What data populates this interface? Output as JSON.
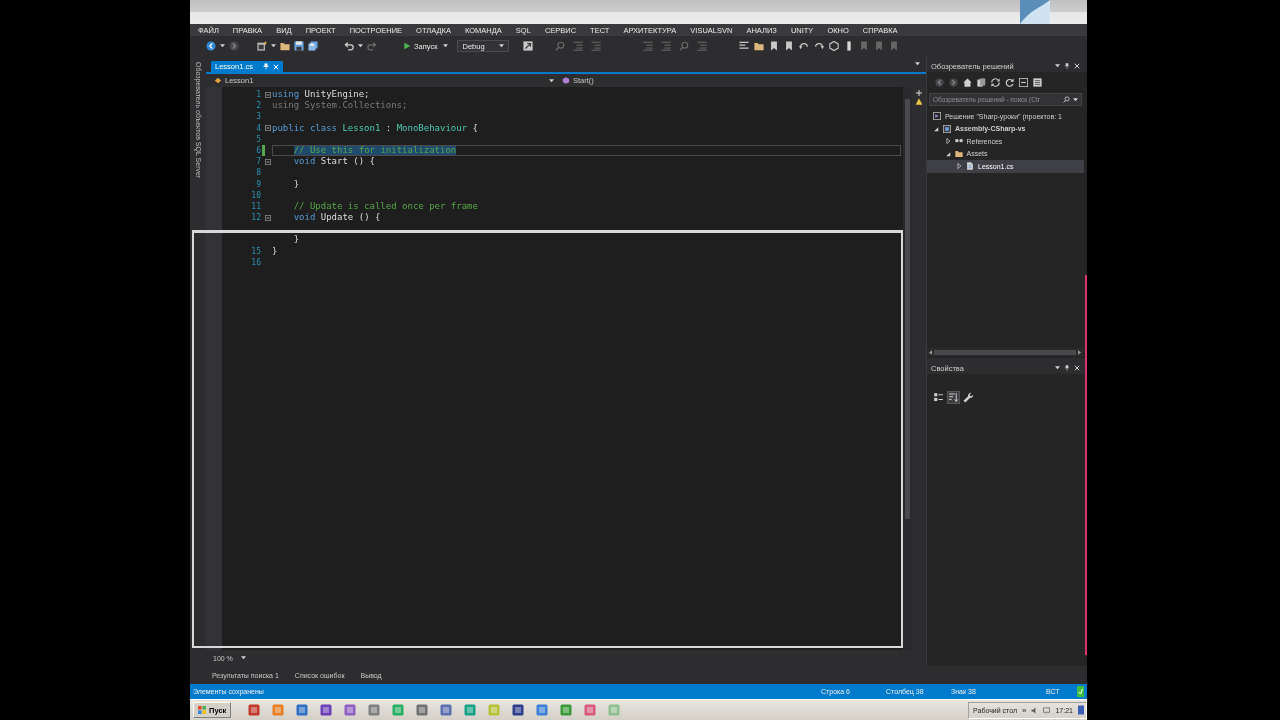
{
  "menu": [
    "ФАЙЛ",
    "ПРАВКА",
    "ВИД",
    "ПРОЕКТ",
    "ПОСТРОЕНИЕ",
    "ОТЛАДКА",
    "КОМАНДА",
    "SQL",
    "СЕРВИС",
    "ТЕСТ",
    "АРХИТЕКТУРА",
    "VISUALSVN",
    "АНАЛИЗ",
    "UNITY",
    "ОКНО",
    "СПРАВКА"
  ],
  "toolbar": {
    "run_label": "Запуск",
    "configuration": "Debug"
  },
  "side_tab": {
    "label": "Обозреватель объектов SQL Server"
  },
  "editor": {
    "tabs": [
      {
        "label": "Lesson1.cs",
        "selected": true
      }
    ],
    "navigation": {
      "type": "Lesson1",
      "member": "Start()"
    },
    "lines": [
      {
        "number": "1",
        "changed": false,
        "foldable": true,
        "current": false,
        "tokens": [
          {
            "text": "using",
            "kind": "keyword",
            "highlighted": false
          },
          {
            "text": " UnityEngine;",
            "kind": "plain",
            "highlighted": false
          }
        ]
      },
      {
        "number": "2",
        "changed": false,
        "foldable": false,
        "current": false,
        "tokens": [
          {
            "text": "using System.Collections;",
            "kind": "dim",
            "highlighted": false
          }
        ]
      },
      {
        "number": "3",
        "changed": false,
        "foldable": false,
        "current": false
      },
      {
        "number": "4",
        "changed": false,
        "foldable": true,
        "current": false,
        "tokens": [
          {
            "text": "public class",
            "kind": "keyword",
            "highlighted": false
          },
          {
            "text": " Lesson1",
            "kind": "type",
            "highlighted": false
          },
          {
            "text": " : ",
            "kind": "plain",
            "highlighted": false
          },
          {
            "text": "MonoBehaviour",
            "kind": "type",
            "highlighted": false
          },
          {
            "text": " {",
            "kind": "plain",
            "highlighted": false
          }
        ]
      },
      {
        "number": "5",
        "changed": false,
        "foldable": false,
        "current": false
      },
      {
        "number": "6",
        "changed": true,
        "foldable": false,
        "current": true,
        "tokens": [
          {
            "text": "    // Use this for initialization",
            "kind": "comment",
            "highlighted": true
          }
        ]
      },
      {
        "number": "7",
        "changed": false,
        "foldable": true,
        "current": false,
        "tokens": [
          {
            "text": "    void",
            "kind": "keyword",
            "highlighted": false
          },
          {
            "text": " Start () {",
            "kind": "plain",
            "highlighted": false
          }
        ]
      },
      {
        "number": "8",
        "changed": false,
        "foldable": false,
        "current": false
      },
      {
        "number": "9",
        "changed": false,
        "foldable": false,
        "current": false,
        "tokens": [
          {
            "text": "    }",
            "kind": "plain",
            "highlighted": false
          }
        ]
      },
      {
        "number": "10",
        "changed": false,
        "foldable": false,
        "current": false
      },
      {
        "number": "11",
        "changed": false,
        "foldable": false,
        "current": false,
        "tokens": [
          {
            "text": "    // Update is called once per frame",
            "kind": "comment",
            "highlighted": false
          }
        ]
      },
      {
        "number": "12",
        "changed": false,
        "foldable": true,
        "current": false,
        "tokens": [
          {
            "text": "    void",
            "kind": "keyword",
            "highlighted": false
          },
          {
            "text": " Update () {",
            "kind": "plain",
            "highlighted": false
          }
        ]
      },
      {
        "changed": false,
        "foldable": false,
        "current": false
      },
      {
        "changed": false,
        "foldable": false,
        "current": false,
        "tokens": [
          {
            "text": "    }",
            "kind": "plain",
            "highlighted": false
          }
        ]
      },
      {
        "number": "15",
        "changed": false,
        "foldable": false,
        "current": false,
        "tokens": [
          {
            "text": "}",
            "kind": "plain",
            "highlighted": false
          }
        ]
      },
      {
        "number": "16",
        "changed": false,
        "foldable": false,
        "current": false
      }
    ],
    "zoom": "100 %"
  },
  "solution_explorer": {
    "title": "Обозреватель решений",
    "search": {
      "placeholder": "Обозреватель решений - поиск (Ctr"
    },
    "tree": [
      {
        "label": "Решение \"Sharp-уроки\" (проектов: 1",
        "kind": "solution",
        "selected": false,
        "children": [
          {
            "label": "Assembly-CSharp-vs",
            "kind": "project",
            "expanded": true,
            "selected": false,
            "children": [
              {
                "label": "References",
                "kind": "references",
                "expanded": false,
                "selected": false
              },
              {
                "label": "Assets",
                "kind": "folder",
                "expanded": true,
                "selected": false,
                "children": [
                  {
                    "label": "Lesson1.cs",
                    "kind": "file",
                    "expanded": false,
                    "selected": true
                  }
                ]
              }
            ]
          }
        ]
      }
    ]
  },
  "properties": {
    "title": "Свойства",
    "alphabetical": true
  },
  "bottom_tabs": [
    {
      "label": "Результаты поиска 1",
      "selected": false
    },
    {
      "label": "Список ошибок",
      "selected": false
    },
    {
      "label": "Вывод",
      "selected": false
    }
  ],
  "status_bar": {
    "message": "Элементы сохранены",
    "line": "Строка 6",
    "column": "Столбец 38",
    "char": "Знак 38",
    "mode": "ВСТ"
  },
  "taskbar": {
    "start": "Пуск",
    "desktop": "Рабочий стол",
    "chevron": "»",
    "time": "17:21"
  }
}
